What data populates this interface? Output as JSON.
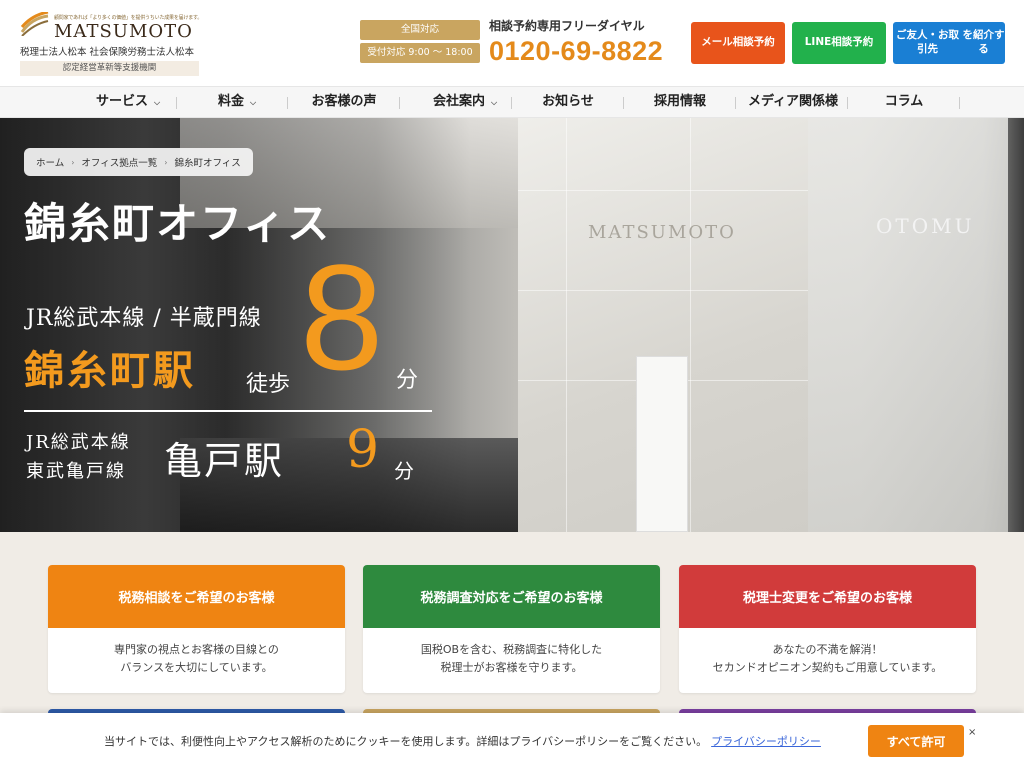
{
  "header": {
    "logo_tagline": "顧問家であれば「より多くの価値」を提供うちいた成果を届けます。",
    "logo_name": "MATSUMOTO",
    "logo_sub": "税理士法人松本 社会保険労務士法人松本",
    "logo_badge": "認定経営革新等支援機関",
    "tag_nationwide": "全国対応",
    "tag_hours": "受付対応 9:00 〜 18:00",
    "dial_label": "相談予約専用フリーダイヤル",
    "dial_number": "0120-69-8822",
    "cta_mail": "メール相談予約",
    "cta_line": "LINE相談予約",
    "cta_intro_1": "ご友人・お取引先",
    "cta_intro_2": "を紹介する"
  },
  "nav": {
    "items": [
      {
        "label": "サービス",
        "has_caret": true
      },
      {
        "label": "料金",
        "has_caret": true
      },
      {
        "label": "お客様の声",
        "has_caret": false
      },
      {
        "label": "会社案内",
        "has_caret": true
      },
      {
        "label": "お知らせ",
        "has_caret": false
      },
      {
        "label": "採用情報",
        "has_caret": false
      },
      {
        "label": "メディア関係様",
        "has_caret": false
      },
      {
        "label": "コラム",
        "has_caret": false
      }
    ]
  },
  "hero": {
    "breadcrumb": [
      "ホーム",
      "オフィス拠点一覧",
      "錦糸町オフィス"
    ],
    "title": "錦糸町オフィス",
    "route1_lines": "JR総武本線 / 半蔵門線",
    "route1_station": "錦糸町駅",
    "route1_walk": "徒歩",
    "route1_minutes": "8",
    "route1_unit": "分",
    "route2_line_a": "JR総武本線",
    "route2_line_b": "東武亀戸線",
    "route2_station": "亀戸駅",
    "route2_minutes": "9",
    "route2_unit": "分",
    "wall_logo": "MATSUMOTO",
    "glass_logo": "OTOMU"
  },
  "cards": [
    {
      "title": "税務相談をご希望のお客様",
      "line1": "専門家の視点とお客様の目線との",
      "line2": "バランスを大切にしています。",
      "color": "#ef8412"
    },
    {
      "title": "税務調査対応をご希望のお客様",
      "line1": "国税OBを含む、税務調査に特化した",
      "line2": "税理士がお客様を守ります。",
      "color": "#2e8a3e"
    },
    {
      "title": "税理士変更をご希望のお客様",
      "line1": "あなたの不満を解消！",
      "line2": "セカンドオピニオン契約もご用意しています。",
      "color": "#d13b3b"
    }
  ],
  "cookie": {
    "text": "当サイトでは、利便性向上やアクセス解析のためにクッキーを使用します。詳細はプライバシーポリシーをご覧ください。",
    "link": "プライバシーポリシー",
    "accept": "すべて許可",
    "close": "×"
  }
}
